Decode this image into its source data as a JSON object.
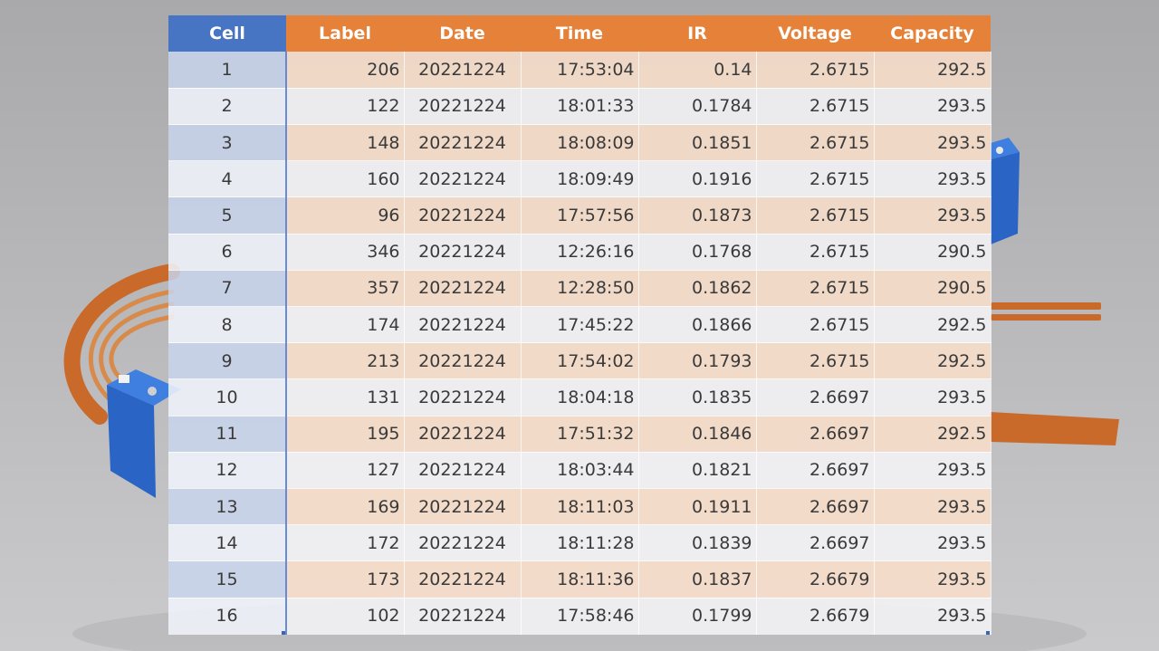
{
  "table": {
    "headers": [
      "Cell",
      "Label",
      "Date",
      "Time",
      "IR",
      "Voltage",
      "Capacity"
    ],
    "rows": [
      [
        "1",
        "206",
        "20221224",
        "17:53:04",
        "0.14",
        "2.6715",
        "292.5"
      ],
      [
        "2",
        "122",
        "20221224",
        "18:01:33",
        "0.1784",
        "2.6715",
        "293.5"
      ],
      [
        "3",
        "148",
        "20221224",
        "18:08:09",
        "0.1851",
        "2.6715",
        "293.5"
      ],
      [
        "4",
        "160",
        "20221224",
        "18:09:49",
        "0.1916",
        "2.6715",
        "293.5"
      ],
      [
        "5",
        "96",
        "20221224",
        "17:57:56",
        "0.1873",
        "2.6715",
        "293.5"
      ],
      [
        "6",
        "346",
        "20221224",
        "12:26:16",
        "0.1768",
        "2.6715",
        "290.5"
      ],
      [
        "7",
        "357",
        "20221224",
        "12:28:50",
        "0.1862",
        "2.6715",
        "290.5"
      ],
      [
        "8",
        "174",
        "20221224",
        "17:45:22",
        "0.1866",
        "2.6715",
        "292.5"
      ],
      [
        "9",
        "213",
        "20221224",
        "17:54:02",
        "0.1793",
        "2.6715",
        "292.5"
      ],
      [
        "10",
        "131",
        "20221224",
        "18:04:18",
        "0.1835",
        "2.6697",
        "293.5"
      ],
      [
        "11",
        "195",
        "20221224",
        "17:51:32",
        "0.1846",
        "2.6697",
        "292.5"
      ],
      [
        "12",
        "127",
        "20221224",
        "18:03:44",
        "0.1821",
        "2.6697",
        "293.5"
      ],
      [
        "13",
        "169",
        "20221224",
        "18:11:03",
        "0.1911",
        "2.6697",
        "293.5"
      ],
      [
        "14",
        "172",
        "20221224",
        "18:11:28",
        "0.1839",
        "2.6697",
        "293.5"
      ],
      [
        "15",
        "173",
        "20221224",
        "18:11:36",
        "0.1837",
        "2.6679",
        "293.5"
      ],
      [
        "16",
        "102",
        "20221224",
        "17:58:46",
        "0.1799",
        "2.6679",
        "293.5"
      ]
    ]
  },
  "colors": {
    "cell_header": "#4272c4",
    "header": "#e87e32",
    "band_orange": "#f9deca",
    "band_blue": "#c8d6ee",
    "battery_blue": "#2f6fd0",
    "copper_strip": "#c96a2a"
  }
}
